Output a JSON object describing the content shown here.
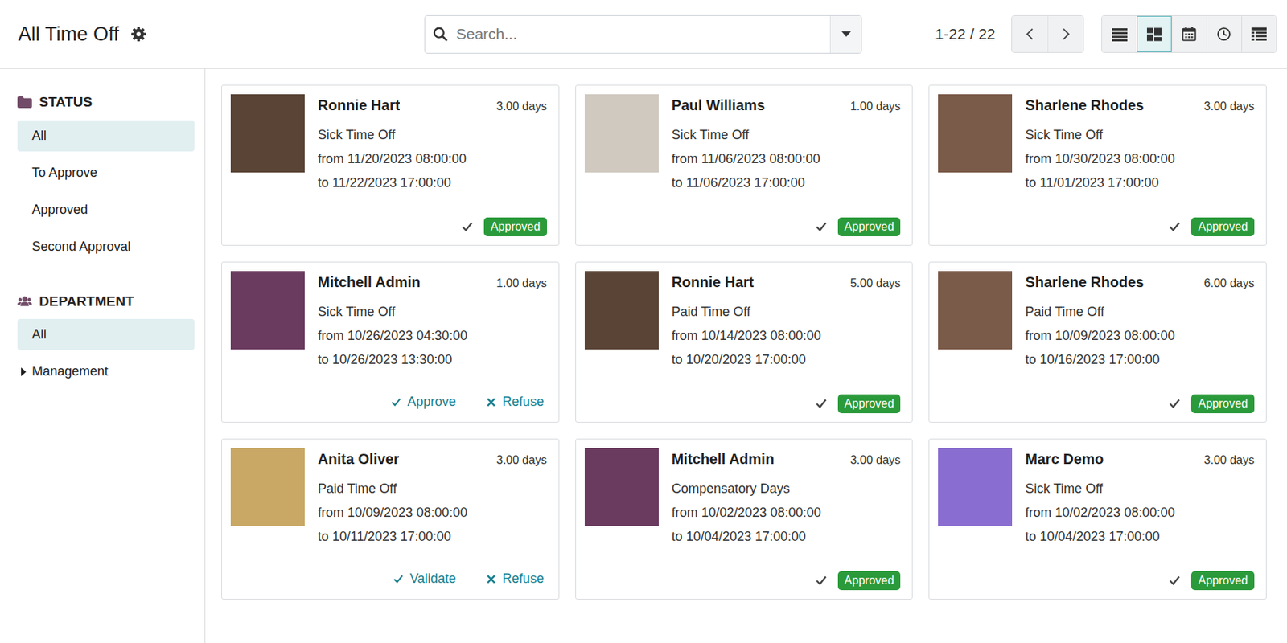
{
  "window": {
    "title": "All Time Off"
  },
  "search": {
    "placeholder": "Search..."
  },
  "pager": "1-22 / 22",
  "views": [
    {
      "kind": "list",
      "selected": false
    },
    {
      "kind": "kanban",
      "selected": true
    },
    {
      "kind": "calendar",
      "selected": false
    },
    {
      "kind": "activity",
      "selected": false
    },
    {
      "kind": "gantt",
      "selected": false
    }
  ],
  "sidebar": {
    "sections": [
      {
        "title": "STATUS",
        "kind": "folder",
        "items": [
          {
            "label": "All",
            "selected": true
          },
          {
            "label": "To Approve",
            "selected": false
          },
          {
            "label": "Approved",
            "selected": false
          },
          {
            "label": "Second Approval",
            "selected": false
          }
        ]
      },
      {
        "title": "DEPARTMENT",
        "kind": "users",
        "items": [
          {
            "label": "All",
            "selected": true
          },
          {
            "label": "Management",
            "selected": false,
            "expanded": false
          }
        ]
      }
    ]
  },
  "cards": [
    {
      "name": "Ronnie Hart",
      "duration": "3.00 days",
      "type": "Sick Time Off",
      "from": "from 11/20/2023 08:00:00",
      "to": "to 11/22/2023 17:00:00",
      "color": "#5a4436",
      "kind": "approved",
      "status": "Approved"
    },
    {
      "name": "Paul Williams",
      "duration": "1.00 days",
      "type": "Sick Time Off",
      "from": "from 11/06/2023 08:00:00",
      "to": "to 11/06/2023 17:00:00",
      "color": "#cfc9c0",
      "kind": "approved",
      "status": "Approved"
    },
    {
      "name": "Sharlene Rhodes",
      "duration": "3.00 days",
      "type": "Sick Time Off",
      "from": "from 10/30/2023 08:00:00",
      "to": "to 11/01/2023 17:00:00",
      "color": "#7a5a48",
      "kind": "approved",
      "status": "Approved"
    },
    {
      "name": "Mitchell Admin",
      "duration": "1.00 days",
      "type": "Sick Time Off",
      "from": "from 10/26/2023 04:30:00",
      "to": "to 10/26/2023 13:30:00",
      "color": "#6a3a5f",
      "kind": "pending",
      "actions": [
        {
          "label": "Approve",
          "kind": "accept"
        },
        {
          "label": "Refuse",
          "kind": "reject"
        }
      ]
    },
    {
      "name": "Ronnie Hart",
      "duration": "5.00 days",
      "type": "Paid Time Off",
      "from": "from 10/14/2023 08:00:00",
      "to": "to 10/20/2023 17:00:00",
      "color": "#5a4436",
      "kind": "approved",
      "status": "Approved"
    },
    {
      "name": "Sharlene Rhodes",
      "duration": "6.00 days",
      "type": "Paid Time Off",
      "from": "from 10/09/2023 08:00:00",
      "to": "to 10/16/2023 17:00:00",
      "color": "#7a5a48",
      "kind": "approved",
      "status": "Approved"
    },
    {
      "name": "Anita Oliver",
      "duration": "3.00 days",
      "type": "Paid Time Off",
      "from": "from 10/09/2023 08:00:00",
      "to": "to 10/11/2023 17:00:00",
      "color": "#c9a865",
      "kind": "pending",
      "actions": [
        {
          "label": "Validate",
          "kind": "accept"
        },
        {
          "label": "Refuse",
          "kind": "reject"
        }
      ]
    },
    {
      "name": "Mitchell Admin",
      "duration": "3.00 days",
      "type": "Compensatory Days",
      "from": "from 10/02/2023 08:00:00",
      "to": "to 10/04/2023 17:00:00",
      "color": "#6a3a5f",
      "kind": "approved",
      "status": "Approved"
    },
    {
      "name": "Marc Demo",
      "duration": "3.00 days",
      "type": "Sick Time Off",
      "from": "from 10/02/2023 08:00:00",
      "to": "to 10/04/2023 17:00:00",
      "color": "#8a6dd0",
      "kind": "approved",
      "status": "Approved"
    }
  ]
}
